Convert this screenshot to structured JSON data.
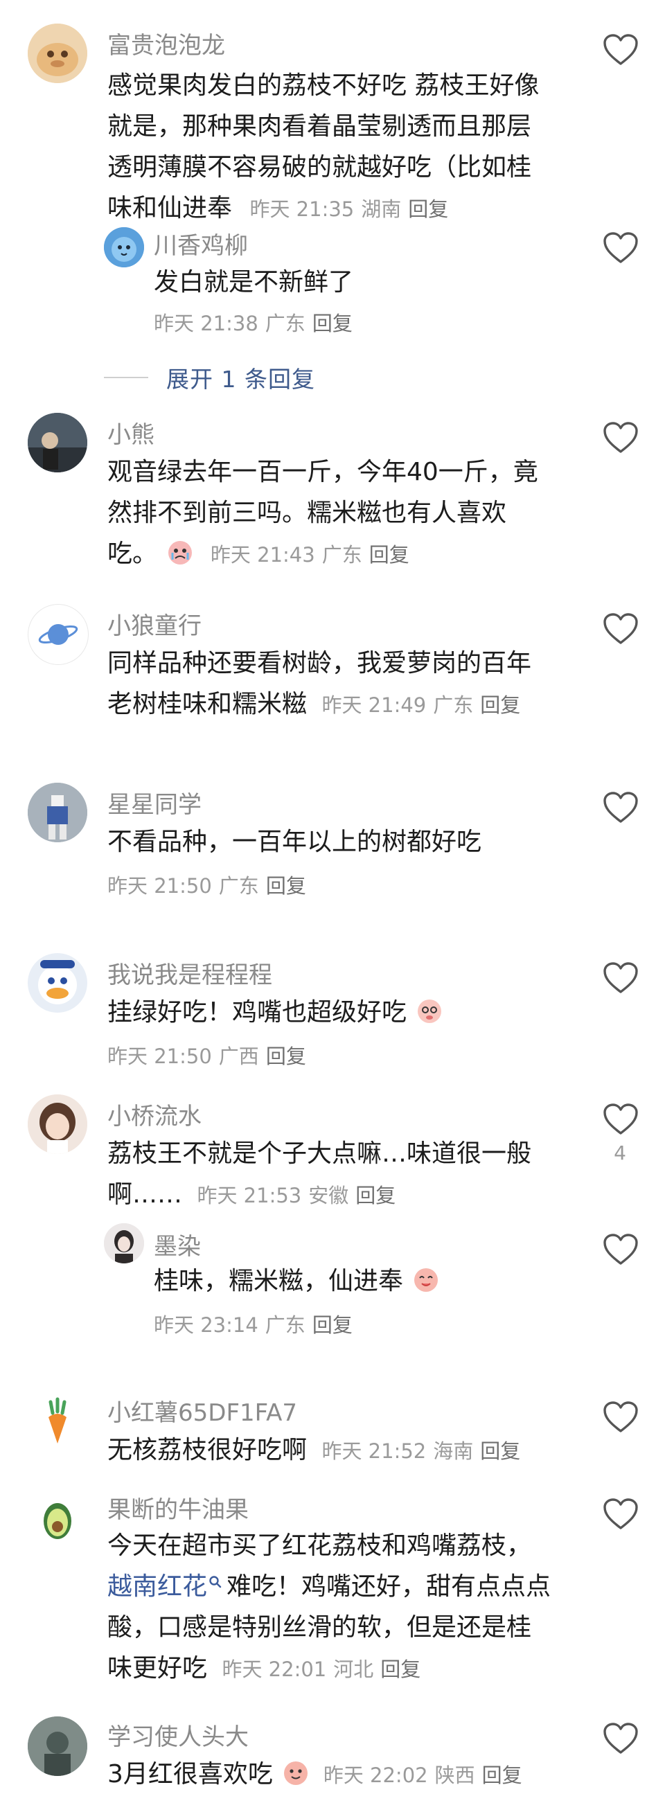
{
  "comments": [
    {
      "name": "富贵泡泡龙",
      "lines": [
        "感觉果肉发白的荔枝不好吃 荔枝王好像",
        "就是，那种果肉看着晶莹剔透而且那层",
        "透明薄膜不容易破的就越好吃（比如桂",
        "味和仙进奉"
      ],
      "time": "昨天 21:35",
      "loc": "湖南",
      "reply": "回复"
    },
    {
      "name": "川香鸡柳",
      "lines": [
        "发白就是不新鲜了"
      ],
      "time": "昨天 21:38",
      "loc": "广东",
      "reply": "回复"
    },
    {
      "name": "小熊",
      "lines": [
        "观音绿去年一百一斤，今年40一斤，竟",
        "然排不到前三吗。糯米糍也有人喜欢",
        "吃。"
      ],
      "time": "昨天 21:43",
      "loc": "广东",
      "reply": "回复"
    },
    {
      "name": "小狼童行",
      "lines": [
        "同样品种还要看树龄，我爱萝岗的百年",
        "老树桂味和糯米糍"
      ],
      "time": "昨天 21:49",
      "loc": "广东",
      "reply": "回复"
    },
    {
      "name": "星星同学",
      "lines": [
        "不看品种，一百年以上的树都好吃"
      ],
      "time": "昨天 21:50",
      "loc": "广东",
      "reply": "回复"
    },
    {
      "name": "我说我是程程程",
      "lines": [
        "挂绿好吃！鸡嘴也超级好吃"
      ],
      "time": "昨天 21:50",
      "loc": "广西",
      "reply": "回复"
    },
    {
      "name": "小桥流水",
      "lines": [
        "荔枝王不就是个子大点嘛…味道很一般",
        "啊……"
      ],
      "time": "昨天 21:53",
      "loc": "安徽",
      "reply": "回复",
      "likes": "4"
    },
    {
      "name": "墨染",
      "lines": [
        "桂味，糯米糍，仙进奉"
      ],
      "time": "昨天 23:14",
      "loc": "广东",
      "reply": "回复"
    },
    {
      "name": "小红薯65DF1FA7",
      "lines": [
        "无核荔枝很好吃啊"
      ],
      "time": "昨天 21:52",
      "loc": "海南",
      "reply": "回复"
    },
    {
      "name": "果断的牛油果",
      "lines": [
        "今天在超市买了红花荔枝和鸡嘴荔枝，",
        "难吃！鸡嘴还好，甜有点点点",
        "酸，口感是特别丝滑的软，但是还是桂",
        "味更好吃"
      ],
      "link": "越南红花",
      "time": "昨天 22:01",
      "loc": "河北",
      "reply": "回复"
    },
    {
      "name": "学习使人头大",
      "lines": [
        "3月红很喜欢吃"
      ],
      "time": "昨天 22:02",
      "loc": "陕西",
      "reply": "回复"
    }
  ],
  "expand_replies": "展开 1 条回复"
}
